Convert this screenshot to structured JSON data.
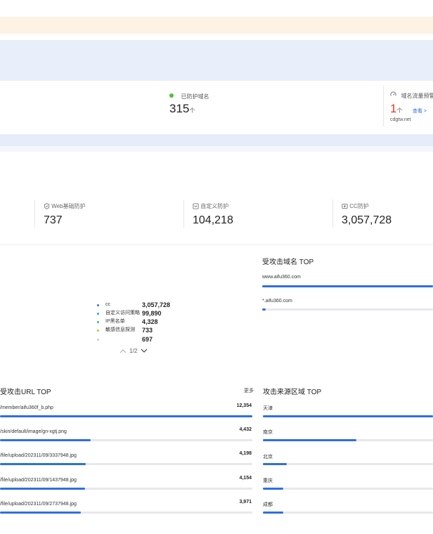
{
  "summary": {
    "protected_domains": {
      "label": "已防护域名",
      "value": "315",
      "unit": "个"
    },
    "traffic_alert": {
      "label": "域名流量预警",
      "value": "1",
      "unit": "个",
      "link": "查看 >",
      "domain": "cdgtw.net"
    }
  },
  "protection": [
    {
      "label": "Web基础防护",
      "value": "737",
      "icon": "shield-icon"
    },
    {
      "label": "自定义防护",
      "value": "104,218",
      "icon": "custom-rule-icon"
    },
    {
      "label": "CC防护",
      "value": "3,057,728",
      "icon": "cc-icon"
    }
  ],
  "legend": {
    "items": [
      {
        "name": "cc",
        "value": "3,057,728",
        "color": "#2e6fe0"
      },
      {
        "name": "自定义访问策略",
        "value": "99,890",
        "color": "#1fa3e8"
      },
      {
        "name": "IP黑名单",
        "value": "4,328",
        "color": "#2bb5a0"
      },
      {
        "name": "敏感信息探测",
        "value": "733",
        "color": "#9bd33a"
      }
    ],
    "clipped_value": "697",
    "pager": "1/2"
  },
  "attacked_domains": {
    "title": "受攻击域名 TOP",
    "items": [
      {
        "label": "www.aifu360.com",
        "fraction": 1.0
      },
      {
        "label": "*.aifu360.com",
        "fraction": 0.02
      }
    ]
  },
  "attacked_urls": {
    "title": "受攻击URL TOP",
    "more": "更多",
    "items": [
      {
        "label": "/member/aifu360f_b.php",
        "value": "12,354",
        "fraction": 1.0
      },
      {
        "label": "/skin/default/image/gn-xgtj.png",
        "value": "4,432",
        "fraction": 0.36
      },
      {
        "label": "/file/upload/202311/09/3337948.jpg",
        "value": "4,198",
        "fraction": 0.34
      },
      {
        "label": "/file/upload/202311/09/1437948.jpg",
        "value": "4,154",
        "fraction": 0.336
      },
      {
        "label": "/file/upload/202311/09/2737948.jpg",
        "value": "3,971",
        "fraction": 0.32
      }
    ]
  },
  "source_regions": {
    "title": "攻击来源区域 TOP",
    "items": [
      {
        "label": "天津",
        "fraction": 1.0
      },
      {
        "label": "南京",
        "fraction": 0.55
      },
      {
        "label": "北京",
        "fraction": 0.14
      },
      {
        "label": "重庆",
        "fraction": 0.12
      },
      {
        "label": "成都",
        "fraction": 0.12
      }
    ]
  }
}
